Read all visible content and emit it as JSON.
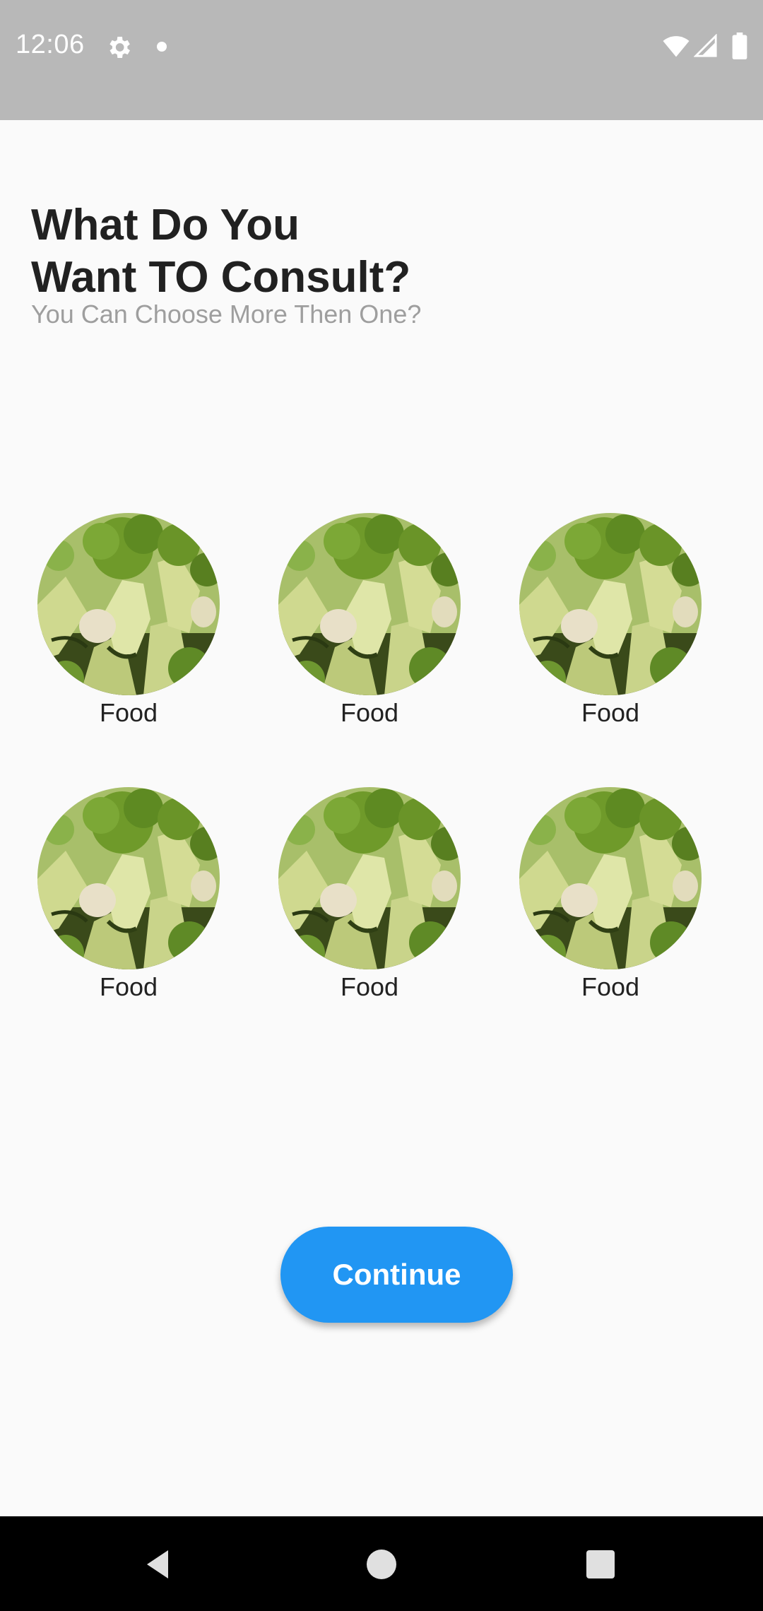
{
  "status_bar": {
    "time": "12:06",
    "icons": [
      "gear-icon",
      "notification-dot-icon",
      "wifi-icon",
      "signal-icon",
      "battery-icon"
    ]
  },
  "header": {
    "title": "What Do You\nWant TO Consult?",
    "subtitle": "You Can Choose More Then One?"
  },
  "categories": [
    {
      "label": "Food",
      "image": "broccoli"
    },
    {
      "label": "Food",
      "image": "broccoli"
    },
    {
      "label": "Food",
      "image": "broccoli"
    },
    {
      "label": "Food",
      "image": "broccoli"
    },
    {
      "label": "Food",
      "image": "broccoli"
    },
    {
      "label": "Food",
      "image": "broccoli"
    }
  ],
  "actions": {
    "continue_label": "Continue"
  },
  "nav_bar": {
    "icons": [
      "back-icon",
      "home-icon",
      "recents-icon"
    ]
  },
  "colors": {
    "status_bar": "#b8b8b8",
    "background": "#fafafa",
    "primary": "#2196f3",
    "title": "#212121",
    "subtitle": "#9e9e9e"
  }
}
